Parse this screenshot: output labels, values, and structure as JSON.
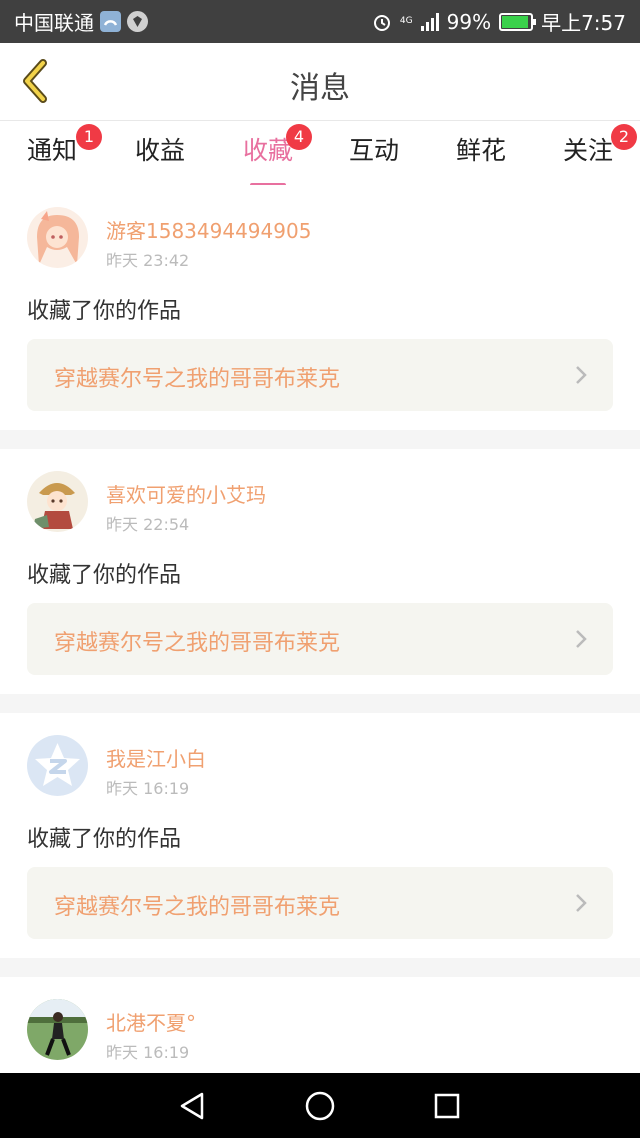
{
  "status_bar": {
    "carrier": "中国联通",
    "network": "4G",
    "battery": "99%",
    "time": "早上7:57"
  },
  "header": {
    "title": "消息",
    "back_icon": "chevron-left-icon"
  },
  "tabs": [
    {
      "label": "通知",
      "badge": "1"
    },
    {
      "label": "收益",
      "badge": ""
    },
    {
      "label": "收藏",
      "badge": "4",
      "active": true
    },
    {
      "label": "互动",
      "badge": ""
    },
    {
      "label": "鲜花",
      "badge": ""
    },
    {
      "label": "关注",
      "badge": "2"
    }
  ],
  "feed": [
    {
      "user": "游客1583494494905",
      "time": "昨天 23:42",
      "action": "收藏了你的作品",
      "work": "穿越赛尔号之我的哥哥布莱克"
    },
    {
      "user": "喜欢可爱的小艾玛",
      "time": "昨天 22:54",
      "action": "收藏了你的作品",
      "work": "穿越赛尔号之我的哥哥布莱克"
    },
    {
      "user": "我是江小白",
      "time": "昨天 16:19",
      "action": "收藏了你的作品",
      "work": "穿越赛尔号之我的哥哥布莱克"
    },
    {
      "user": "北港不夏°",
      "time": "昨天 16:19",
      "action": "",
      "work": ""
    }
  ],
  "colors": {
    "accent_pink": "#e8709f",
    "name_orange": "#f0a070",
    "badge_red": "#f03a45"
  }
}
